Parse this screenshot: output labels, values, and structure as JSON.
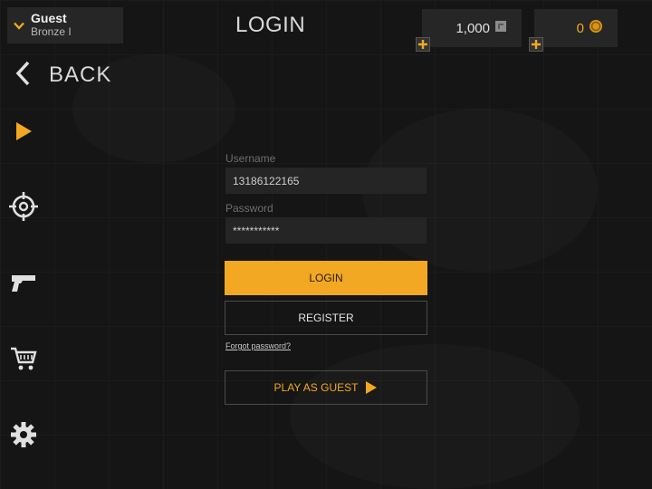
{
  "header": {
    "profile": {
      "name": "Guest",
      "rank": "Bronze I"
    },
    "title": "LOGIN",
    "currency": {
      "scrap": {
        "amount": "1,000",
        "icon": "scrap-token-icon"
      },
      "gold": {
        "amount": "0",
        "icon": "gold-coin-icon"
      }
    }
  },
  "nav": {
    "back_label": "BACK",
    "items": [
      {
        "id": "play",
        "icon": "play-icon"
      },
      {
        "id": "target",
        "icon": "crosshair-icon"
      },
      {
        "id": "weapons",
        "icon": "pistol-icon"
      },
      {
        "id": "shop",
        "icon": "cart-icon"
      },
      {
        "id": "settings",
        "icon": "gear-icon"
      }
    ]
  },
  "form": {
    "username_label": "Username",
    "username_value": "13186122165",
    "password_label": "Password",
    "password_value": "***********",
    "login_button": "LOGIN",
    "register_button": "REGISTER",
    "forgot_link": "Forgot password?",
    "guest_button": "PLAY AS GUEST"
  },
  "colors": {
    "accent": "#f2a823",
    "background": "#151515",
    "panel": "#262626"
  }
}
